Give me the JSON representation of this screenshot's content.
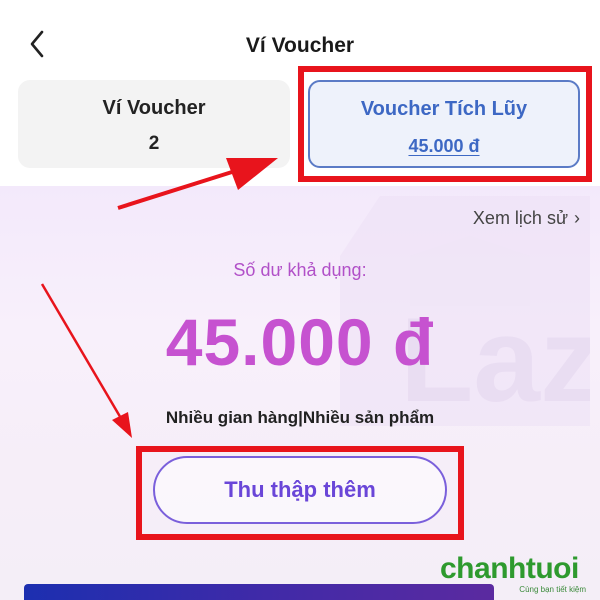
{
  "header": {
    "title": "Ví Voucher",
    "back_icon": "chevron-left-icon"
  },
  "tabs": [
    {
      "label": "Ví Voucher",
      "value": "2",
      "selected": false
    },
    {
      "label": "Voucher Tích Lũy",
      "value": "45.000 đ",
      "selected": true
    }
  ],
  "content": {
    "history_link": "Xem lịch sử",
    "history_icon": "chevron-right-icon",
    "balance_label": "Số dư khả dụng:",
    "balance_amount": "45.000 đ",
    "scope_text": "Nhiều gian hàng|Nhiều sản phẩm",
    "collect_button": "Thu thập thêm",
    "watermark_text": "Laz"
  },
  "brand": {
    "name": "chanhtuoi",
    "tagline": "Cùng bạn tiết kiệm"
  },
  "colors": {
    "accent_blue": "#3d68c4",
    "balance_purple": "#c652d0",
    "button_purple": "#6a46d8",
    "annotation_red": "#e8141c",
    "brand_green": "#2e9a2e"
  }
}
